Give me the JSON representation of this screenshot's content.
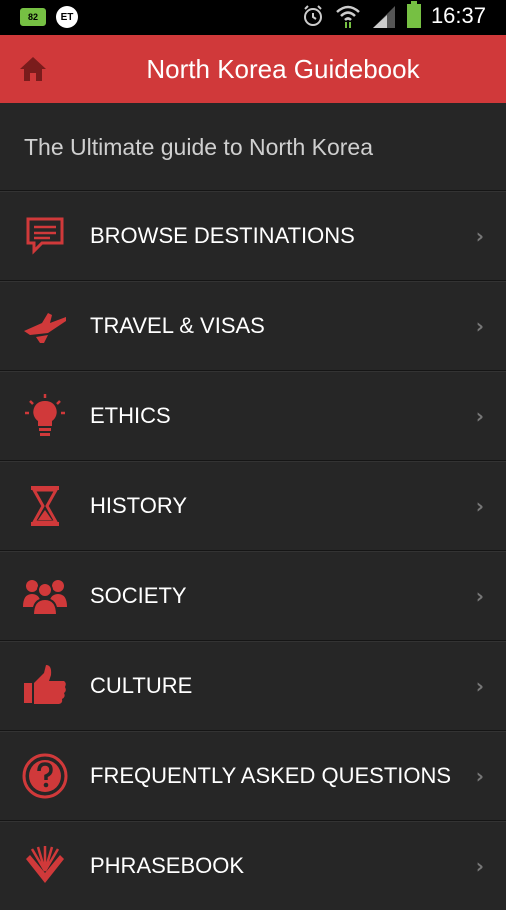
{
  "status_bar": {
    "battery_badge": "82",
    "carrier_badge": "ET",
    "time": "16:37",
    "icons": [
      "alarm-icon",
      "wifi-icon",
      "signal-icon",
      "battery-icon"
    ]
  },
  "app_bar": {
    "title": "North Korea Guidebook",
    "home_icon": "home-icon",
    "background": "#d0393a"
  },
  "subtitle": "The Ultimate guide to North Korea",
  "menu": {
    "accent": "#d0393a",
    "items": [
      {
        "label": "BROWSE DESTINATIONS",
        "icon": "speech-bubble-icon"
      },
      {
        "label": "TRAVEL & VISAS",
        "icon": "airplane-icon"
      },
      {
        "label": "ETHICS",
        "icon": "lightbulb-icon"
      },
      {
        "label": "HISTORY",
        "icon": "hourglass-icon"
      },
      {
        "label": "SOCIETY",
        "icon": "people-icon"
      },
      {
        "label": "CULTURE",
        "icon": "thumbs-up-icon"
      },
      {
        "label": "FREQUENTLY ASKED QUESTIONS",
        "icon": "question-mark-icon"
      },
      {
        "label": "PHRASEBOOK",
        "icon": "book-icon"
      }
    ]
  }
}
